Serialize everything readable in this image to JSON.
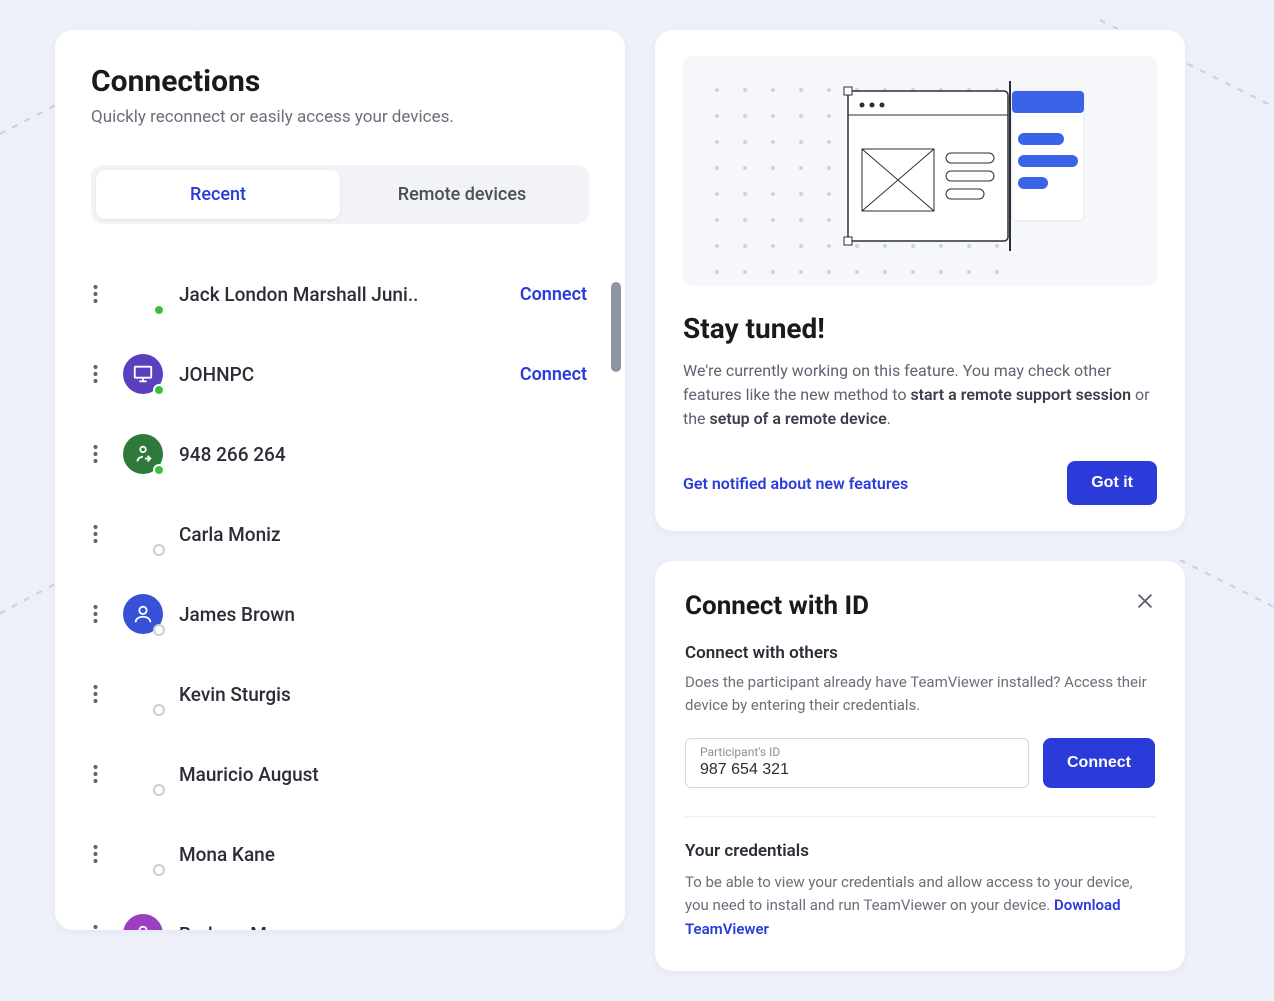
{
  "connections": {
    "title": "Connections",
    "subtitle": "Quickly reconnect or easily access your devices.",
    "tabs": {
      "recent": "Recent",
      "remote": "Remote devices"
    },
    "connect_label": "Connect",
    "items": [
      {
        "name": "Jack London Marshall Juni..",
        "icon": "none",
        "color": "",
        "status": "online",
        "action": true
      },
      {
        "name": "JOHNPC",
        "icon": "monitor",
        "color": "#5a3fbf",
        "status": "online",
        "action": true
      },
      {
        "name": "948 266 264",
        "icon": "transfer",
        "color": "#2e7a3a",
        "status": "online",
        "action": false
      },
      {
        "name": "Carla Moniz",
        "icon": "none",
        "color": "",
        "status": "offline",
        "action": false
      },
      {
        "name": "James Brown",
        "icon": "person",
        "color": "#3650d6",
        "status": "offline",
        "action": false
      },
      {
        "name": "Kevin Sturgis",
        "icon": "none",
        "color": "",
        "status": "offline",
        "action": false
      },
      {
        "name": "Mauricio August",
        "icon": "none",
        "color": "",
        "status": "offline",
        "action": false
      },
      {
        "name": "Mona Kane",
        "icon": "none",
        "color": "",
        "status": "offline",
        "action": false
      },
      {
        "name": "Barbara Moore",
        "icon": "person",
        "color": "#9a3fbf",
        "status": "offline",
        "action": false
      }
    ]
  },
  "stay_tuned": {
    "title": "Stay tuned!",
    "body_prefix": "We're currently working on this feature. You may check other features like the new method to ",
    "body_strong1": "start a remote support session",
    "body_mid": " or the ",
    "body_strong2": "setup of a remote device",
    "body_suffix": ".",
    "notify_link": "Get notified about new features",
    "got_it": "Got it"
  },
  "connect_id": {
    "title": "Connect with ID",
    "section_title": "Connect with others",
    "section_desc": "Does the participant already have TeamViewer installed? Access their device by entering their credentials.",
    "input_label": "Participant's ID",
    "input_value": "987 654 321",
    "connect_btn": "Connect",
    "cred_title": "Your credentials",
    "cred_desc": "To be able to view your credentials and allow access to your device, you need to install and run TeamViewer on your device.  ",
    "download_link": "Download TeamViewer"
  }
}
